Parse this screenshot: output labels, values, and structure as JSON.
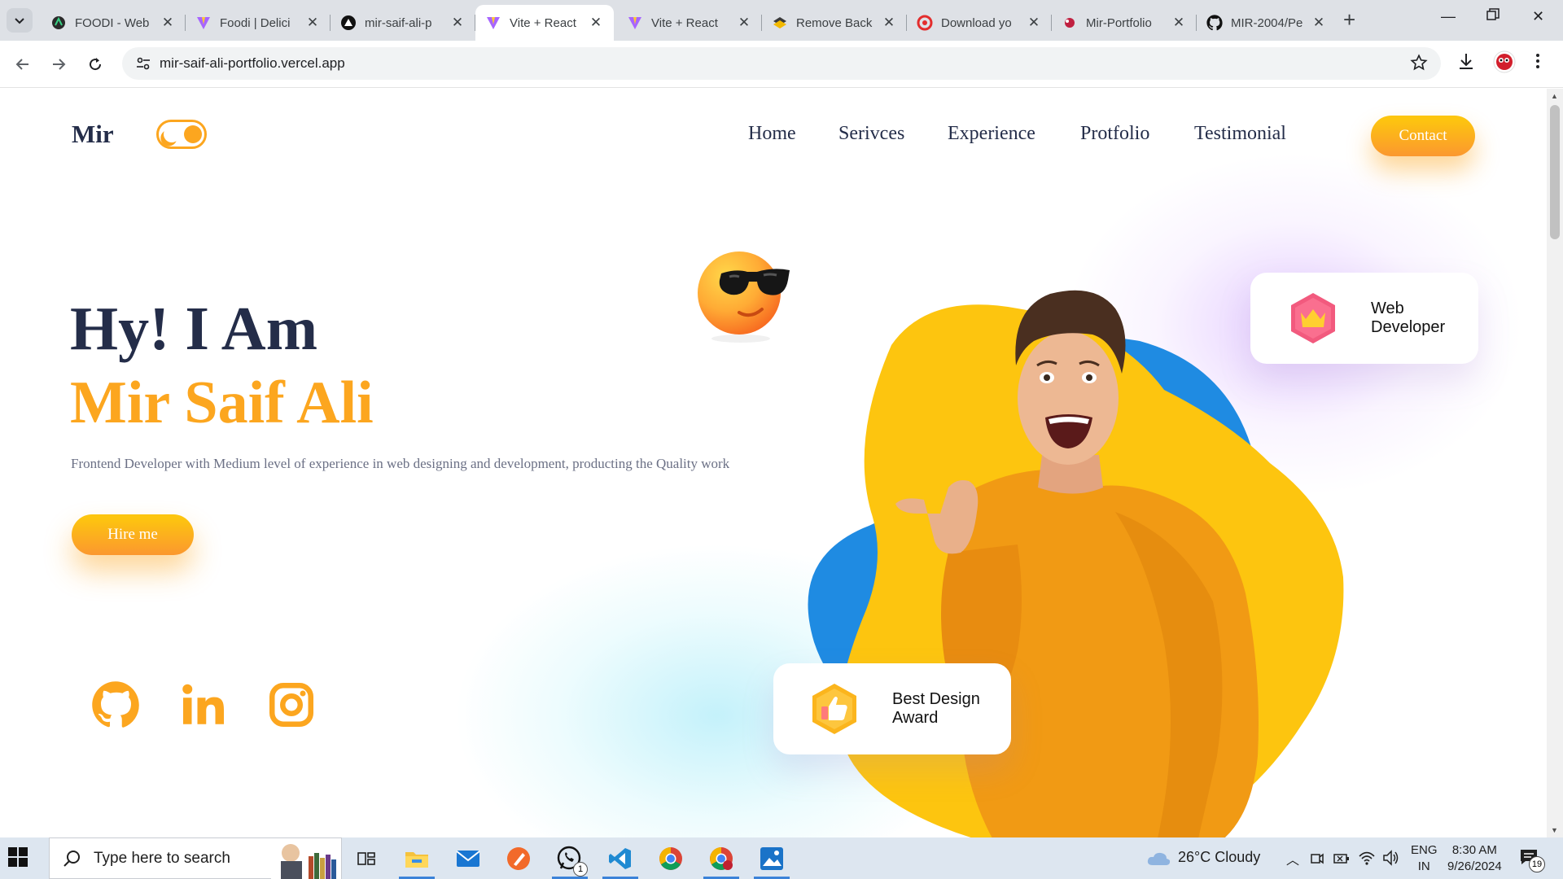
{
  "browser": {
    "tabs": [
      {
        "title": "FOODI - Web",
        "favicon": "foodi-icon",
        "active": false
      },
      {
        "title": "Foodi | Delici",
        "favicon": "vite-icon",
        "active": false
      },
      {
        "title": "mir-saif-ali-p",
        "favicon": "vercel-icon",
        "active": false
      },
      {
        "title": "Vite + React",
        "favicon": "vite-icon",
        "active": true
      },
      {
        "title": "Vite + React",
        "favicon": "vite-icon",
        "active": false
      },
      {
        "title": "Remove Back",
        "favicon": "remove-bg-icon",
        "active": false
      },
      {
        "title": "Download yo",
        "favicon": "download-icon",
        "active": false
      },
      {
        "title": "Mir-Portfolio",
        "favicon": "portfolio-icon",
        "active": false
      },
      {
        "title": "MIR-2004/Pe",
        "favicon": "github-icon",
        "active": false
      }
    ],
    "url": "mir-saif-ali-portfolio.vercel.app"
  },
  "site": {
    "logo": "Mir",
    "nav": [
      "Home",
      "Serivces",
      "Experience",
      "Protfolio",
      "Testimonial"
    ],
    "contact_label": "Contact",
    "hero": {
      "greeting": "Hy! I Am",
      "name": "Mir Saif Ali",
      "description": "Frontend Developer with Medium level of experience in web designing and development, producting the Quality work",
      "hire_label": "Hire me"
    },
    "social": [
      "github-icon",
      "linkedin-icon",
      "instagram-icon"
    ],
    "cards": {
      "web_dev": [
        "Web",
        "Developer"
      ],
      "award": [
        "Best Design",
        "Award"
      ]
    },
    "colors": {
      "accent": "#fca61f",
      "dark": "#242d49",
      "blob_yellow": "#fdc50f",
      "blob_blue": "#1f8be2"
    }
  },
  "taskbar": {
    "search_placeholder": "Type here to search",
    "weather": "26°C  Cloudy",
    "lang": [
      "ENG",
      "IN"
    ],
    "time": "8:30 AM",
    "date": "9/26/2024",
    "notification_count": "19",
    "whatsapp_badge": "1"
  }
}
